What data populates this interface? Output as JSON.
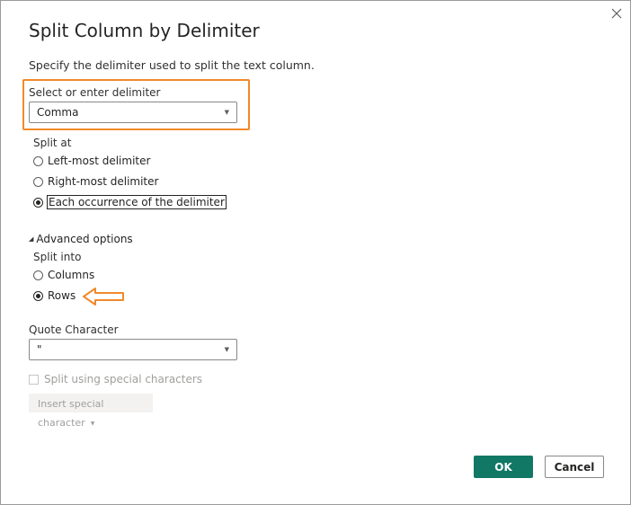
{
  "dialog": {
    "title": "Split Column by Delimiter",
    "description": "Specify the delimiter used to split the text column.",
    "close_icon": "close-icon"
  },
  "delimiter": {
    "label": "Select or enter delimiter",
    "value": "Comma"
  },
  "split_at": {
    "label": "Split at",
    "options": [
      {
        "label": "Left-most delimiter",
        "checked": false
      },
      {
        "label": "Right-most delimiter",
        "checked": false
      },
      {
        "label": "Each occurrence of the delimiter",
        "checked": true
      }
    ]
  },
  "advanced": {
    "toggle_label": "Advanced options",
    "split_into": {
      "label": "Split into",
      "options": [
        {
          "label": "Columns",
          "checked": false
        },
        {
          "label": "Rows",
          "checked": true
        }
      ]
    },
    "quote_character": {
      "label": "Quote Character",
      "value": "\""
    },
    "special_chars": {
      "label": "Split using special characters",
      "checked": false,
      "insert_button": "Insert special character"
    }
  },
  "buttons": {
    "ok": "OK",
    "cancel": "Cancel"
  },
  "colors": {
    "highlight": "#f08a2b",
    "primary": "#117865"
  }
}
